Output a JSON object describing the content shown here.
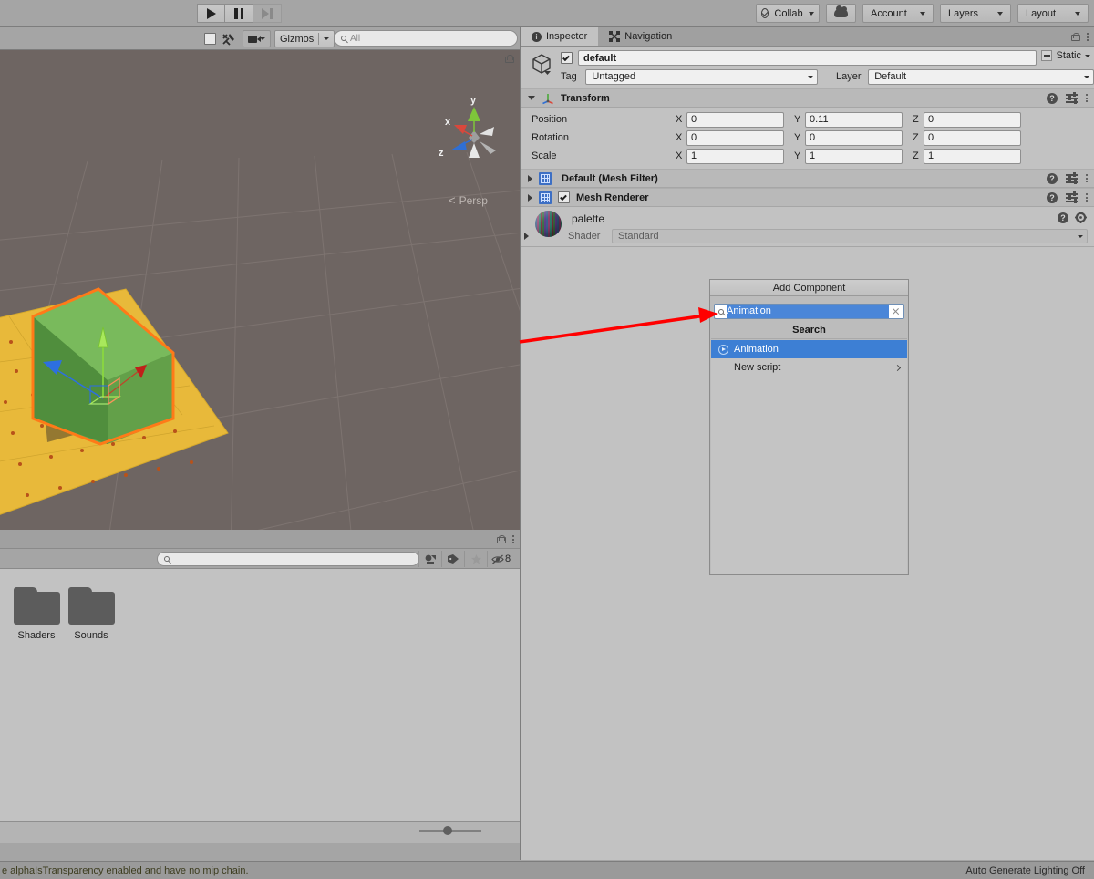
{
  "toolbar": {
    "play_label": "play-icon",
    "pause_label": "pause-icon",
    "step_label": "step-icon",
    "collab": "Collab",
    "cloud": "cloud-icon",
    "account": "Account",
    "layers": "Layers",
    "layout": "Layout"
  },
  "scene_view": {
    "gizmos_label": "Gizmos",
    "search_placeholder": "All",
    "search_value": "",
    "perspective_label": "Persp",
    "axis_x": "x",
    "axis_y": "y",
    "axis_z": "z",
    "colors": {
      "background": "#6e6562",
      "cube": "#6aa84f",
      "selection_outline": "#ff7a18",
      "ground": "#e8b93a",
      "axis_x": "#d92b21",
      "axis_y": "#8ddb3c",
      "axis_z": "#2d6fe0"
    }
  },
  "project_browser": {
    "search_placeholder": "",
    "search_value": "",
    "hidden_count": "8",
    "items": [
      {
        "label": "Shaders",
        "icon": "folder-icon"
      },
      {
        "label": "Sounds",
        "icon": "folder-icon"
      }
    ]
  },
  "inspector": {
    "tabs": [
      {
        "label": "Inspector",
        "icon": "info-icon",
        "active": true
      },
      {
        "label": "Navigation",
        "icon": "navigation-icon",
        "active": false
      }
    ],
    "game_object": {
      "name": "default",
      "enabled": true,
      "static_label": "Static",
      "tag_label": "Tag",
      "tag_value": "Untagged",
      "layer_label": "Layer",
      "layer_value": "Default"
    },
    "transform": {
      "title": "Transform",
      "rows": [
        {
          "label": "Position",
          "x": "0",
          "y": "0.11",
          "z": "0"
        },
        {
          "label": "Rotation",
          "x": "0",
          "y": "0",
          "z": "0"
        },
        {
          "label": "Scale",
          "x": "1",
          "y": "1",
          "z": "1"
        }
      ],
      "axis_x": "X",
      "axis_y": "Y",
      "axis_z": "Z"
    },
    "components": [
      {
        "title": "Default (Mesh Filter)",
        "has_checkbox": false
      },
      {
        "title": "Mesh Renderer",
        "has_checkbox": true,
        "checked": true
      }
    ],
    "material": {
      "name": "palette",
      "shader_label": "Shader",
      "shader_value": "Standard"
    }
  },
  "add_component": {
    "button_label": "Add Component",
    "search_value": "Animation",
    "section_label": "Search",
    "items": [
      {
        "label": "Animation",
        "selected": true,
        "has_submenu": false
      },
      {
        "label": "New script",
        "selected": false,
        "has_submenu": true
      }
    ]
  },
  "status_bar": {
    "message": "e alphaIsTransparency enabled and have no mip chain.",
    "lighting": "Auto Generate Lighting Off"
  },
  "annotation": {
    "color": "#ff0000",
    "type": "arrow-pointing-to-search-field"
  }
}
